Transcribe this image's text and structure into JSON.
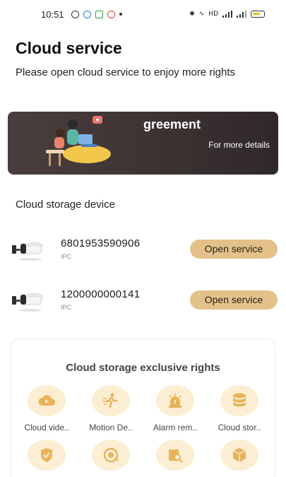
{
  "status_bar": {
    "time": "10:51",
    "right_text": "HD"
  },
  "header": {
    "title": "Cloud service",
    "subtitle": "Please open cloud service to enjoy more rights"
  },
  "banner": {
    "title": "greement",
    "link": "For more details"
  },
  "devices": {
    "section_label": "Cloud storage device",
    "items": [
      {
        "id": "6801953590906",
        "type": "IPC",
        "button": "Open service"
      },
      {
        "id": "1200000000141",
        "type": "IPC",
        "button": "Open service"
      }
    ]
  },
  "rights": {
    "title": "Cloud storage exclusive rights",
    "features": [
      {
        "label": "Cloud vide..",
        "icon": "cloud-video-icon"
      },
      {
        "label": "Motion De..",
        "icon": "motion-detection-icon"
      },
      {
        "label": "Alarm rem..",
        "icon": "alarm-reminder-icon"
      },
      {
        "label": "Cloud stor..",
        "icon": "cloud-storage-icon"
      },
      {
        "label": "",
        "icon": "shield-check-icon"
      },
      {
        "label": "",
        "icon": "playback-icon"
      },
      {
        "label": "",
        "icon": "search-record-icon"
      },
      {
        "label": "",
        "icon": "box-icon"
      }
    ]
  },
  "colors": {
    "accent_button": "#e3c189",
    "feature_circle": "#fbeed2",
    "feature_icon": "#e8b45a",
    "banner_bg": "#3d3333"
  }
}
